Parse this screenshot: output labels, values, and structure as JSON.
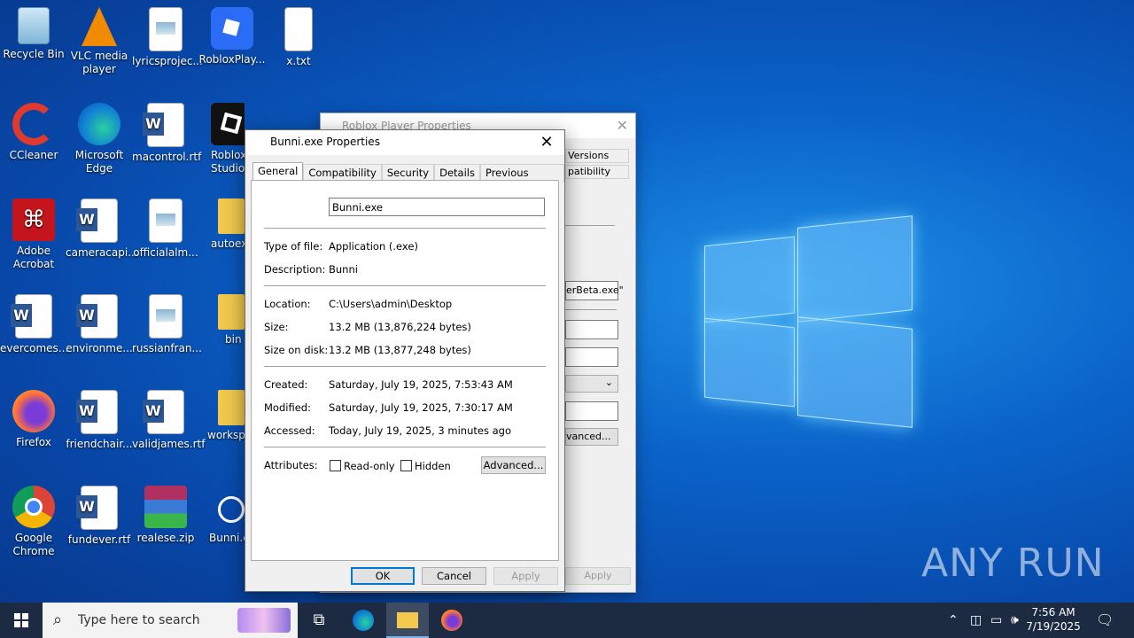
{
  "desktop": {
    "icons": [
      {
        "label": "Recycle Bin"
      },
      {
        "label": "VLC media player"
      },
      {
        "label": "lyricsprojec..."
      },
      {
        "label": "RobloxPlay..."
      },
      {
        "label": "x.txt"
      },
      {
        "label": "CCleaner"
      },
      {
        "label": "Microsoft Edge"
      },
      {
        "label": "macontrol.rtf"
      },
      {
        "label": "Roblox Studio"
      },
      {
        "label": "Adobe Acrobat"
      },
      {
        "label": "cameracapi..."
      },
      {
        "label": "officialalm..."
      },
      {
        "label": "autoex"
      },
      {
        "label": "evercomes..."
      },
      {
        "label": "environme..."
      },
      {
        "label": "russianfran..."
      },
      {
        "label": "bin"
      },
      {
        "label": "Firefox"
      },
      {
        "label": "friendchair..."
      },
      {
        "label": "validjames.rtf"
      },
      {
        "label": "workspa"
      },
      {
        "label": "Google Chrome"
      },
      {
        "label": "fundever.rtf"
      },
      {
        "label": "realese.zip"
      },
      {
        "label": "Bunni.e"
      }
    ],
    "watermark": "ANY RUN"
  },
  "back_window": {
    "title": "Roblox Player Properties",
    "tab_fragments": [
      "Versions",
      "patibility"
    ],
    "target_fragment": "erBeta.exe\"",
    "advanced_fragment": "vanced...",
    "apply_label": "Apply"
  },
  "dialog": {
    "title": "Bunni.exe Properties",
    "tabs": [
      "General",
      "Compatibility",
      "Security",
      "Details",
      "Previous Versions"
    ],
    "file_name": "Bunni.exe",
    "labels": {
      "type": "Type of file:",
      "description": "Description:",
      "location": "Location:",
      "size": "Size:",
      "size_on_disk": "Size on disk:",
      "created": "Created:",
      "modified": "Modified:",
      "accessed": "Accessed:",
      "attributes": "Attributes:"
    },
    "values": {
      "type": "Application (.exe)",
      "description": "Bunni",
      "location": "C:\\Users\\admin\\Desktop",
      "size": "13.2 MB (13,876,224 bytes)",
      "size_on_disk": "13.2 MB (13,877,248 bytes)",
      "created": "Saturday, July 19, 2025, 7:53:43 AM",
      "modified": "Saturday, July 19, 2025, 7:30:17 AM",
      "accessed": "Today, July 19, 2025, 3 minutes ago"
    },
    "attributes": {
      "readonly_label": "Read-only",
      "readonly_checked": false,
      "hidden_label": "Hidden",
      "hidden_checked": false,
      "advanced_label": "Advanced..."
    },
    "buttons": {
      "ok": "OK",
      "cancel": "Cancel",
      "apply": "Apply"
    }
  },
  "taskbar": {
    "search_placeholder": "Type here to search",
    "time": "7:56 AM",
    "date": "7/19/2025"
  }
}
